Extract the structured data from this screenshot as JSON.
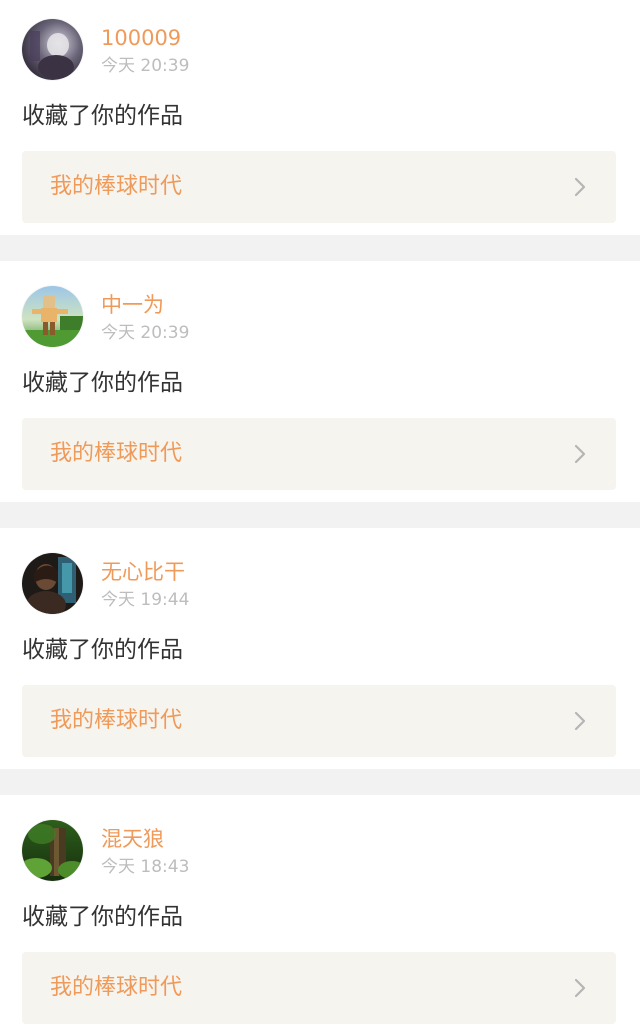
{
  "notifications": [
    {
      "username": "100009",
      "time": "今天 20:39",
      "action": "收藏了你的作品",
      "work_title": "我的棒球时代",
      "avatar_icon": "avatar-dark-figure-icon"
    },
    {
      "username": "中一为",
      "time": "今天 20:39",
      "action": "收藏了你的作品",
      "work_title": "我的棒球时代",
      "avatar_icon": "avatar-blocky-character-icon"
    },
    {
      "username": "无心比干",
      "time": "今天 19:44",
      "action": "收藏了你的作品",
      "work_title": "我的棒球时代",
      "avatar_icon": "avatar-person-icon"
    },
    {
      "username": "混天狼",
      "time": "今天 18:43",
      "action": "收藏了你的作品",
      "work_title": "我的棒球时代",
      "avatar_icon": "avatar-forest-icon"
    }
  ],
  "colors": {
    "accent": "#f09a5a",
    "text_primary": "#333333",
    "text_secondary": "#bdbdbd",
    "link_background": "#f5f4ef",
    "page_background": "#f2f2f2"
  }
}
